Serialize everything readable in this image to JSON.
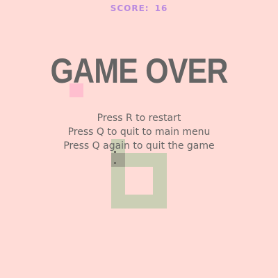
{
  "hud": {
    "score_label": "SCORE:",
    "score_value": "16"
  },
  "overlay": {
    "title": "GAME OVER",
    "instructions": [
      "Press R to restart",
      "Press Q to quit to main menu",
      "Press Q again to quit the game"
    ]
  },
  "colors": {
    "background": "#ffdcd7",
    "score_text": "#b98ae0",
    "food": "#ffbfcf",
    "snake_body": "#cbcfb5",
    "snake_head": "#a4a593",
    "overlay_text": "#646464"
  }
}
